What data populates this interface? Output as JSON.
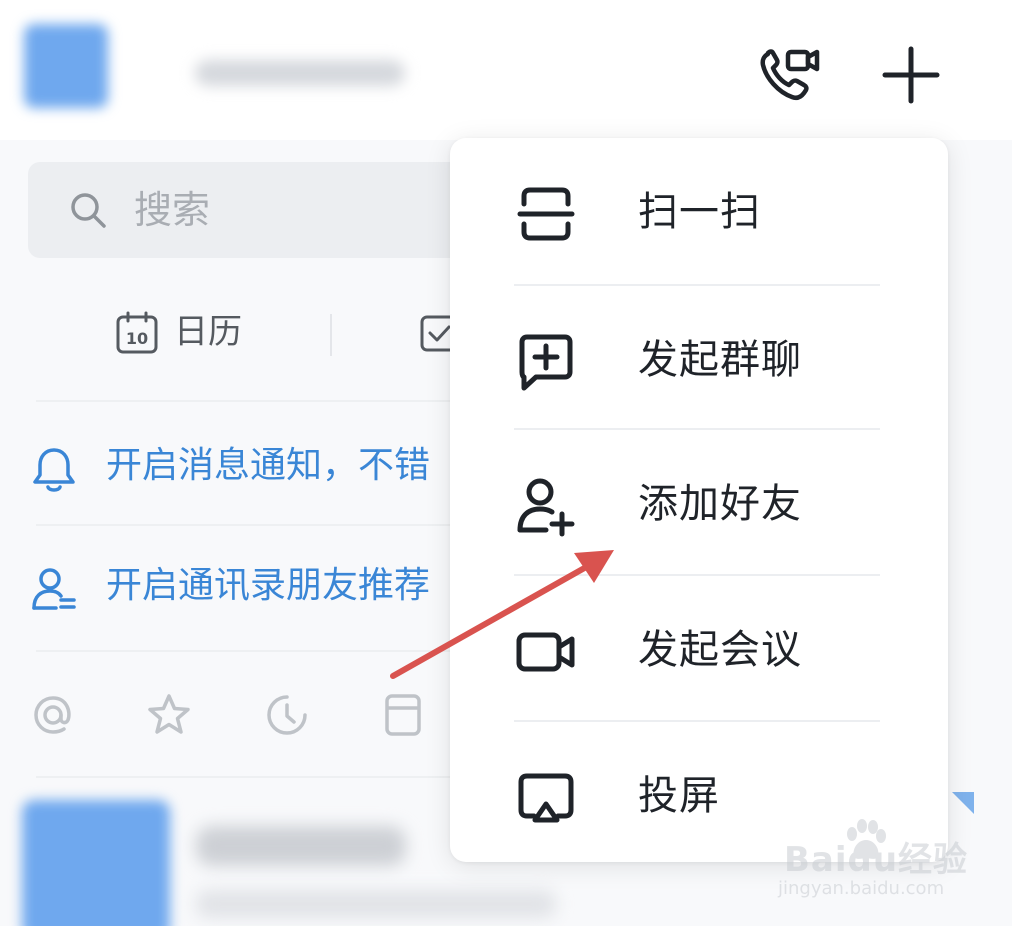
{
  "header": {
    "video_call_icon": "phone-video-icon",
    "add_icon": "plus-icon"
  },
  "search": {
    "placeholder": "搜索"
  },
  "shortcuts": {
    "calendar_label": "日历",
    "calendar_day": "10"
  },
  "notices": [
    {
      "icon": "bell-icon",
      "text": "开启消息通知，不错"
    },
    {
      "icon": "contacts-icon",
      "text": "开启通讯录朋友推荐"
    }
  ],
  "quick_icons": [
    "at-icon",
    "star-icon",
    "clock-icon",
    "cloud-doc-icon"
  ],
  "menu": {
    "items": [
      {
        "icon": "scan-icon",
        "label": "扫一扫"
      },
      {
        "icon": "group-chat-icon",
        "label": "发起群聊"
      },
      {
        "icon": "add-friend-icon",
        "label": "添加好友"
      },
      {
        "icon": "video-meeting-icon",
        "label": "发起会议"
      },
      {
        "icon": "screen-cast-icon",
        "label": "投屏"
      }
    ]
  },
  "colors": {
    "accent": "#3a86d6",
    "arrow": "#d9534f",
    "avatar": "#6fa8ee"
  },
  "watermark": {
    "brand": "Baidu经验",
    "url": "jingyan.baidu.com"
  }
}
